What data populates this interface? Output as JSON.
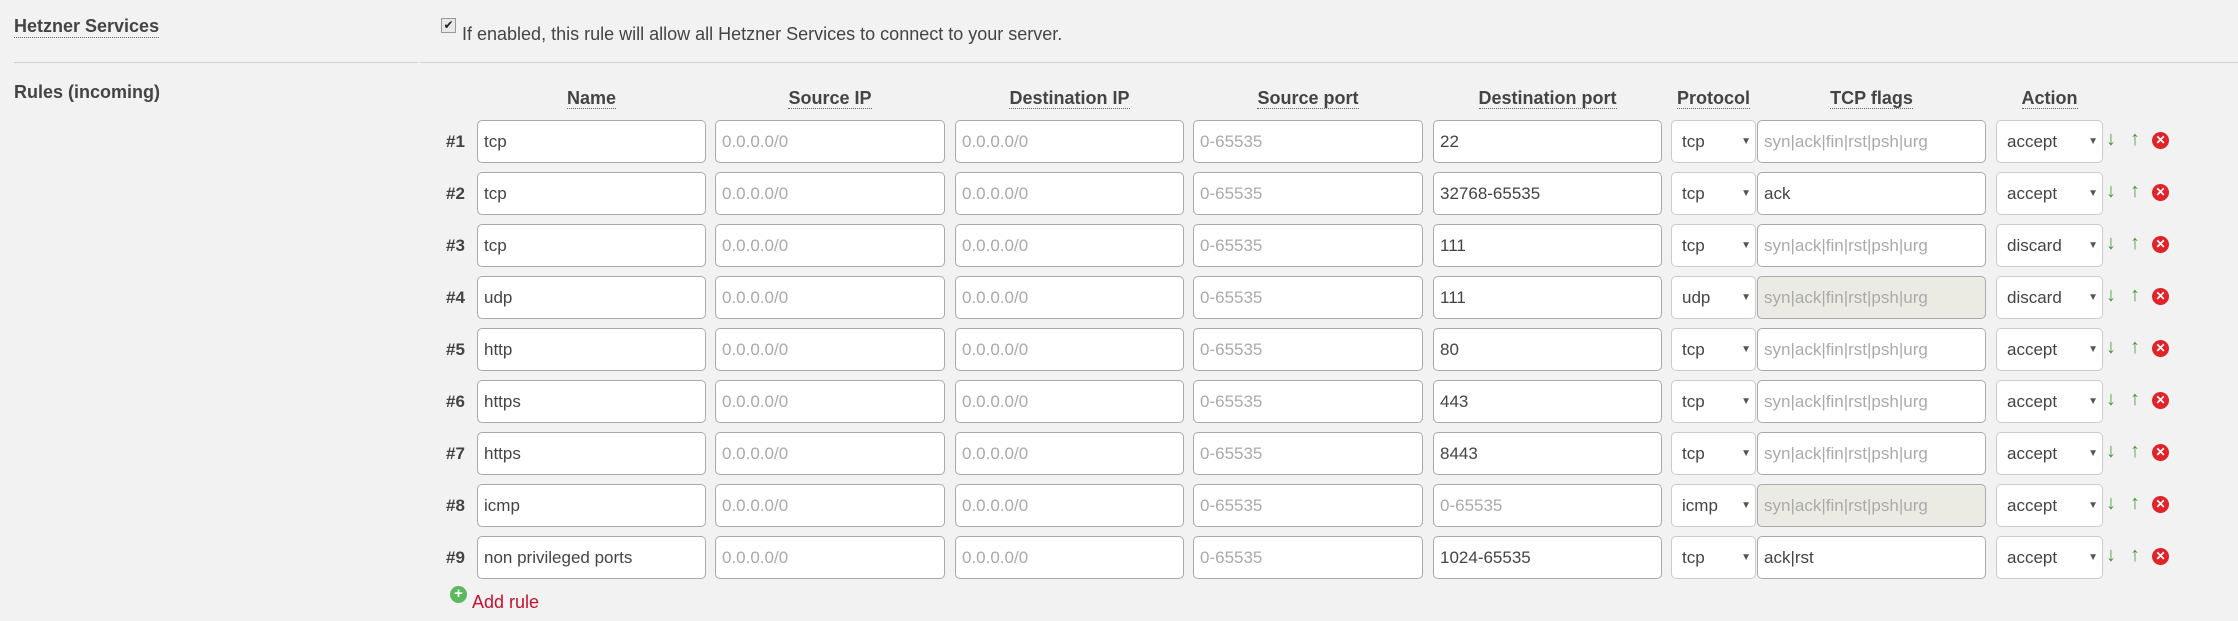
{
  "hetzner_services": {
    "label": "Hetzner Services",
    "checked": true,
    "description": "If enabled, this rule will allow all Hetzner Services to connect to your server."
  },
  "rules": {
    "label": "Rules (incoming)",
    "columns": [
      "Name",
      "Source IP",
      "Destination IP",
      "Source port",
      "Destination port",
      "Protocol",
      "TCP flags",
      "Action"
    ],
    "placeholders": {
      "source_ip": "0.0.0.0/0",
      "destination_ip": "0.0.0.0/0",
      "source_port": "0-65535",
      "destination_port": "0-65535",
      "tcp_flags": "syn|ack|fin|rst|psh|urg"
    },
    "items": [
      {
        "num": "#1",
        "name": "tcp",
        "dest_port": "22",
        "protocol": "tcp",
        "tcp_flags": "",
        "action": "accept"
      },
      {
        "num": "#2",
        "name": "tcp",
        "dest_port": "32768-65535",
        "protocol": "tcp",
        "tcp_flags": "ack",
        "action": "accept"
      },
      {
        "num": "#3",
        "name": "tcp",
        "dest_port": "111",
        "protocol": "tcp",
        "tcp_flags": "",
        "action": "discard"
      },
      {
        "num": "#4",
        "name": "udp",
        "dest_port": "111",
        "protocol": "udp",
        "tcp_flags": "",
        "action": "discard",
        "flags_disabled": true
      },
      {
        "num": "#5",
        "name": "http",
        "dest_port": "80",
        "protocol": "tcp",
        "tcp_flags": "",
        "action": "accept"
      },
      {
        "num": "#6",
        "name": "https",
        "dest_port": "443",
        "protocol": "tcp",
        "tcp_flags": "",
        "action": "accept"
      },
      {
        "num": "#7",
        "name": "https",
        "dest_port": "8443",
        "protocol": "tcp",
        "tcp_flags": "",
        "action": "accept"
      },
      {
        "num": "#8",
        "name": "icmp",
        "dest_port": "",
        "protocol": "icmp",
        "tcp_flags": "",
        "action": "accept",
        "flags_disabled": true
      },
      {
        "num": "#9",
        "name": "non privileged ports",
        "dest_port": "1024-65535",
        "protocol": "tcp",
        "tcp_flags": "ack|rst",
        "action": "accept"
      }
    ],
    "add_label": "Add rule"
  },
  "icons": {
    "move_down": "arrow-down-icon",
    "move_up": "arrow-up-icon",
    "delete": "delete-icon",
    "add": "plus-circle-icon"
  },
  "colors": {
    "arrows": "#4a9a3a",
    "delete": "#e0242a",
    "add_link": "#c8102e"
  }
}
